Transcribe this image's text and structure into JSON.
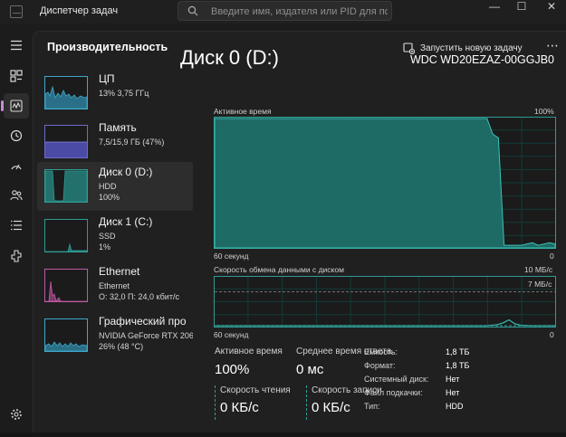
{
  "app": {
    "title": "Диспетчер задач"
  },
  "search": {
    "placeholder": "Введите имя, издателя или PID для поиска"
  },
  "window_controls": {
    "minimize": "—",
    "maximize": "☐",
    "close": "✕"
  },
  "nav": {
    "icons": [
      "hamburger-icon",
      "processes-icon",
      "performance-icon",
      "history-icon",
      "startup-icon",
      "users-icon",
      "details-icon",
      "services-icon",
      "settings-icon"
    ],
    "active": "performance"
  },
  "header": {
    "title": "Производительность",
    "run_task": "Запустить новую задачу",
    "more": "⋯"
  },
  "devices": [
    {
      "name": "ЦП",
      "line2": "13% 3,75 ГГц",
      "line3": ""
    },
    {
      "name": "Память",
      "line2": "7,5/15,9 ГБ (47%)",
      "line3": ""
    },
    {
      "name": "Диск 0 (D:)",
      "line2": "HDD",
      "line3": "100%"
    },
    {
      "name": "Диск 1 (C:)",
      "line2": "SSD",
      "line3": "1%"
    },
    {
      "name": "Ethernet",
      "line2": "Ethernet",
      "line3": "О: 32,0 П: 24,0 кбит/с"
    },
    {
      "name": "Графический про",
      "line2": "NVIDIA GeForce RTX 206",
      "line3": "26% (48 °C)"
    }
  ],
  "accent": {
    "disk": "#2e9c94",
    "cpu": "#3fa7c9",
    "memory": "#6c6ccc",
    "network": "#c05aa5"
  },
  "detail": {
    "title": "Диск 0 (D:)",
    "model": "WDC WD20EZAZ-00GGJB0",
    "active_time_label": "Активное время",
    "active_time_max": "100%",
    "graph1_time": "60 секунд",
    "graph1_min": "0",
    "transfer_label": "Скорость обмена данными с диском",
    "transfer_max": "10 МБ/с",
    "transfer_line": "7 МБ/с",
    "graph2_time": "60 секунд",
    "graph2_min": "0"
  },
  "stats": {
    "active_time": {
      "label": "Активное время",
      "value": "100%"
    },
    "avg_response": {
      "label": "Среднее время ответа",
      "value": "0 мс"
    },
    "read_speed": {
      "label": "Скорость чтения",
      "value": "0 КБ/с"
    },
    "write_speed": {
      "label": "Скорость записи",
      "value": "0 КБ/с"
    }
  },
  "info": [
    {
      "key": "Емкость:",
      "value": "1,8 ТБ"
    },
    {
      "key": "Формат:",
      "value": "1,8 ТБ"
    },
    {
      "key": "Системный диск:",
      "value": "Нет"
    },
    {
      "key": "Файл подкачки:",
      "value": "Нет"
    },
    {
      "key": "Тип:",
      "value": "HDD"
    }
  ],
  "chart_data": [
    {
      "type": "area",
      "title": "Активное время",
      "xlabel": "60 секунд",
      "ylim": [
        0,
        100
      ],
      "x": [
        0,
        2,
        3,
        4,
        6,
        8,
        9,
        10,
        11,
        12,
        13,
        14,
        15,
        16,
        17,
        18,
        19,
        20,
        21,
        22,
        23,
        24,
        25,
        26,
        27,
        28,
        29,
        30,
        31,
        32,
        33,
        34,
        35,
        36,
        37,
        38,
        39,
        40,
        41,
        42,
        43,
        44,
        45,
        46,
        47,
        48,
        49,
        50,
        51,
        52,
        53,
        54,
        55,
        56,
        57,
        58,
        59,
        60
      ],
      "series": [
        {
          "values": [
            100,
            100,
            100,
            100,
            100,
            100,
            100,
            100,
            100,
            100,
            100,
            100,
            100,
            100,
            100,
            100,
            100,
            100,
            100,
            100,
            100,
            100,
            100,
            100,
            100,
            100,
            100,
            100,
            100,
            100,
            100,
            100,
            100,
            100,
            100,
            100,
            100,
            100,
            100,
            100,
            100,
            100,
            100,
            100,
            100,
            100,
            88,
            85,
            2,
            2,
            2,
            2,
            3,
            4,
            2,
            3,
            4,
            3
          ]
        }
      ]
    },
    {
      "type": "line",
      "title": "Скорость обмена данными с диском",
      "xlabel": "60 секунд",
      "ylim": [
        0,
        10
      ],
      "series": [
        {
          "name": "Скорость чтения",
          "values": [
            0,
            0,
            0,
            0,
            0,
            0,
            0,
            0,
            0,
            0,
            0,
            0,
            0,
            0,
            0,
            0,
            0,
            0,
            0,
            0,
            0,
            0,
            0,
            0,
            0,
            0,
            0,
            0,
            0,
            0,
            0,
            0,
            0,
            0,
            0,
            0,
            0,
            0,
            0,
            0,
            0,
            0,
            0,
            0,
            0,
            0,
            0,
            0,
            0.1,
            0.2,
            0.6,
            1.2,
            0.4,
            0.1,
            0.05,
            0,
            0,
            0,
            0,
            0
          ]
        },
        {
          "name": "Скорость записи",
          "values": [
            0,
            0,
            0,
            0,
            0,
            0,
            0,
            0,
            0,
            0,
            0,
            0,
            0,
            0,
            0,
            0,
            0,
            0,
            0,
            0,
            0,
            0,
            0,
            0,
            0,
            0,
            0,
            0,
            0,
            0,
            0,
            0,
            0,
            0,
            0,
            0,
            0,
            0,
            0,
            0,
            0,
            0,
            0,
            0,
            0,
            0,
            0,
            0,
            0,
            0,
            0,
            0,
            0,
            0,
            0,
            0,
            0,
            0,
            0,
            0
          ]
        }
      ]
    }
  ]
}
